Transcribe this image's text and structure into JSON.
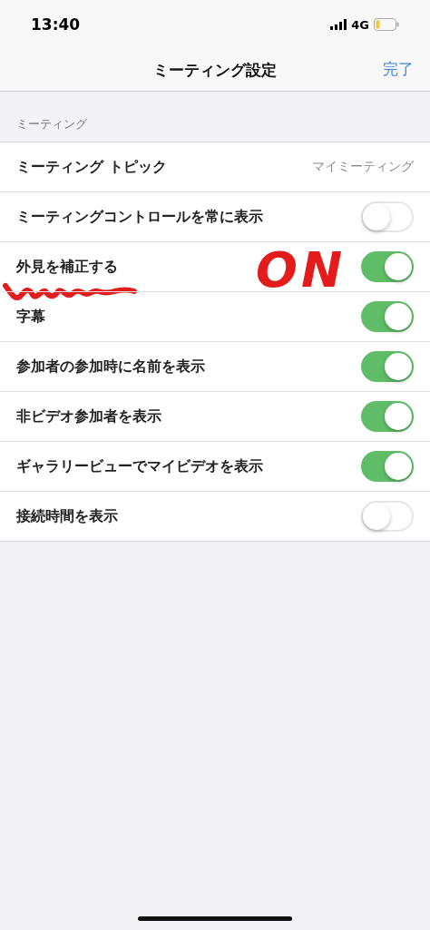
{
  "status_bar": {
    "time": "13:40",
    "network": "4G"
  },
  "nav": {
    "title": "ミーティング設定",
    "done": "完了"
  },
  "section": {
    "header": "ミーティング"
  },
  "rows": [
    {
      "kind": "value",
      "label": "ミーティング トピック",
      "value": "マイミーティング"
    },
    {
      "kind": "toggle",
      "label": "ミーティングコントロールを常に表示",
      "on": false
    },
    {
      "kind": "toggle",
      "label": "外見を補正する",
      "on": true,
      "annotation": "ON"
    },
    {
      "kind": "toggle",
      "label": "字幕",
      "on": true
    },
    {
      "kind": "toggle",
      "label": "参加者の参加時に名前を表示",
      "on": true
    },
    {
      "kind": "toggle",
      "label": "非ビデオ参加者を表示",
      "on": true
    },
    {
      "kind": "toggle",
      "label": "ギャラリービューでマイビデオを表示",
      "on": true
    },
    {
      "kind": "toggle",
      "label": "接続時間を表示",
      "on": false
    }
  ]
}
